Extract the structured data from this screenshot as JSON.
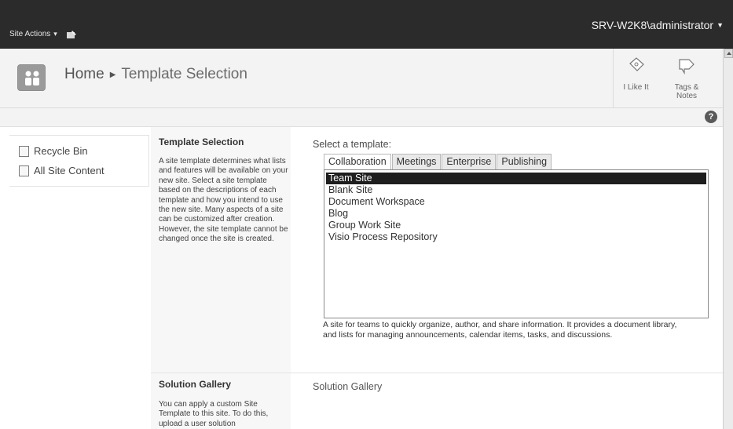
{
  "topbar": {
    "site_actions_label": "Site Actions",
    "user_label": "SRV-W2K8\\administrator"
  },
  "title": {
    "home": "Home",
    "current": "Template Selection"
  },
  "social": {
    "like_label_1": "I Like It",
    "tags_label_1": "Tags &",
    "tags_label_2": "Notes"
  },
  "leftnav": {
    "items": [
      {
        "label": "Recycle Bin",
        "icon": "recycle-bin-icon"
      },
      {
        "label": "All Site Content",
        "icon": "all-site-content-icon"
      }
    ]
  },
  "template_section": {
    "title": "Template Selection",
    "description": "A site template determines what lists and features will be available on your new site. Select a site template based on the descriptions of each template and how you intend to use the new site. Many aspects of a site can be customized after creation. However, the site template cannot be changed once the site is created."
  },
  "selector": {
    "label": "Select a template:",
    "tabs": [
      "Collaboration",
      "Meetings",
      "Enterprise",
      "Publishing"
    ],
    "active_tab": "Collaboration",
    "templates": [
      "Team Site",
      "Blank Site",
      "Document Workspace",
      "Blog",
      "Group Work Site",
      "Visio Process Repository"
    ],
    "selected_template": "Team Site",
    "template_description": "A site for teams to quickly organize, author, and share information. It provides a document library, and lists for managing announcements, calendar items, tasks, and discussions."
  },
  "solution_section": {
    "title": "Solution Gallery",
    "description": "You can apply a custom Site Template to this site. To do this, upload a user solution",
    "field_label": "Solution Gallery"
  },
  "colors": {
    "ribbon": "#2b2b2b",
    "title_bg": "#f3f3f3",
    "selected_row": "#1e1e1e"
  }
}
